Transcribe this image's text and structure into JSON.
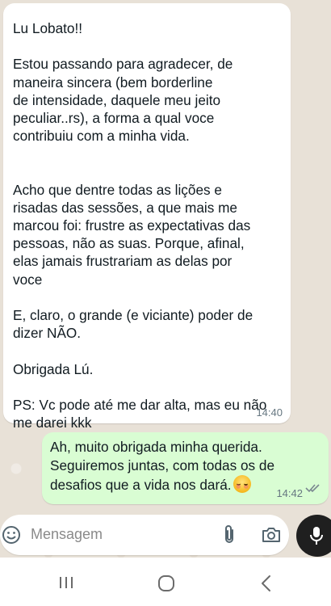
{
  "incoming_message": {
    "lines": [
      "Lu Lobato!!",
      "",
      "Estou passando para agradecer, de",
      "maneira sincera (bem borderline",
      "de intensidade, daquele meu jeito",
      "peculiar..rs), a forma a qual voce",
      "contribuiu com a minha vida.",
      "",
      "",
      "Acho que dentre todas as lições e",
      "risadas das sessões, a que mais me",
      "marcou foi: frustre as expectativas das",
      "pessoas, não as suas. Porque, afinal,",
      "elas jamais frustrariam as delas por",
      "voce",
      "",
      "E, claro, o grande (e viciante) poder de",
      "dizer NÃO.",
      "",
      "Obrigada Lú.",
      "",
      "PS: Vc pode até me dar alta, mas eu não",
      "me darei kkk"
    ],
    "time": "14:40"
  },
  "outgoing_message": {
    "lines": [
      "Ah, muito obrigada minha querida.",
      "Seguiremos juntas, com todas os de",
      "desafios que a vida nos dará."
    ],
    "emoji": "smiling-face-with-smiling-eyes",
    "time": "14:42",
    "status": "read"
  },
  "composer": {
    "placeholder": "Mensagem",
    "icons": [
      "emoji-icon",
      "attach-icon",
      "camera-icon",
      "mic-icon"
    ]
  },
  "nav": {
    "icons": [
      "recent-apps-icon",
      "home-icon",
      "back-icon"
    ]
  },
  "colors": {
    "outgoing_bubble": "#d9fdd3",
    "incoming_bubble": "#ffffff",
    "read_ticks": "#7a8790"
  }
}
